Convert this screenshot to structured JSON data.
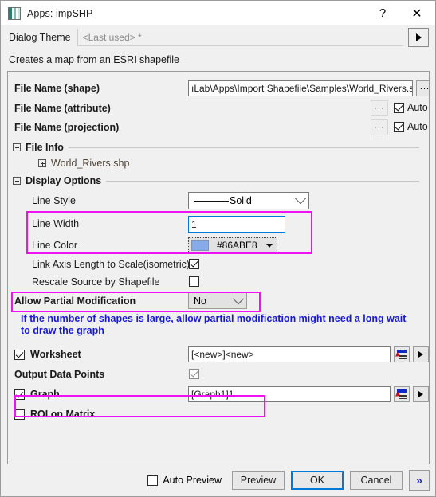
{
  "window": {
    "title": "Apps: impSHP",
    "icon": "app-chart-icon",
    "help_label": "?",
    "close_label": "✕"
  },
  "theme": {
    "label": "Dialog Theme",
    "value": "",
    "placeholder": "<Last used> *",
    "arrow_label": "▶"
  },
  "description": "Creates a map from an ESRI shapefile",
  "files": {
    "shape_label": "File Name (shape)",
    "shape_value": "ıLab\\Apps\\Import Shapefile\\Samples\\World_Rivers.s",
    "attribute_label": "File Name (attribute)",
    "projection_label": "File Name (projection)",
    "browse_label": "...",
    "auto_label": "Auto",
    "attribute_auto_checked": true,
    "projection_auto_checked": true
  },
  "file_info": {
    "title": "File Info",
    "items": [
      {
        "name": "World_Rivers.shp"
      }
    ]
  },
  "display_options": {
    "title": "Display Options",
    "line_style_label": "Line Style",
    "line_style_value": "Solid",
    "line_width_label": "Line Width",
    "line_width_value": "1",
    "line_color_label": "Line Color",
    "line_color_value": "#86ABE8",
    "line_color_hex": "#86ABE8",
    "link_axis_label": "Link Axis Length to Scale(isometric)",
    "link_axis_checked": true,
    "rescale_label": "Rescale Source by Shapefile",
    "rescale_checked": false
  },
  "partial_modification": {
    "label": "Allow Partial Modification",
    "value": "No",
    "warning": "If the number of shapes is large, allow partial modification might need a long wait to draw the graph"
  },
  "outputs": {
    "worksheet_label": "Worksheet",
    "worksheet_checked": true,
    "worksheet_value": "[<new>]<new>",
    "output_points_label": "Output Data Points",
    "output_points_checked": true,
    "graph_label": "Graph",
    "graph_checked": true,
    "graph_value": "[Graph1]1",
    "roi_label": "ROI on Matrix",
    "roi_checked": false
  },
  "footer": {
    "auto_preview_label": "Auto Preview",
    "auto_preview_checked": false,
    "preview_label": "Preview",
    "ok_label": "OK",
    "cancel_label": "Cancel",
    "more_label": "»"
  },
  "highlight_color": "#F012F0"
}
